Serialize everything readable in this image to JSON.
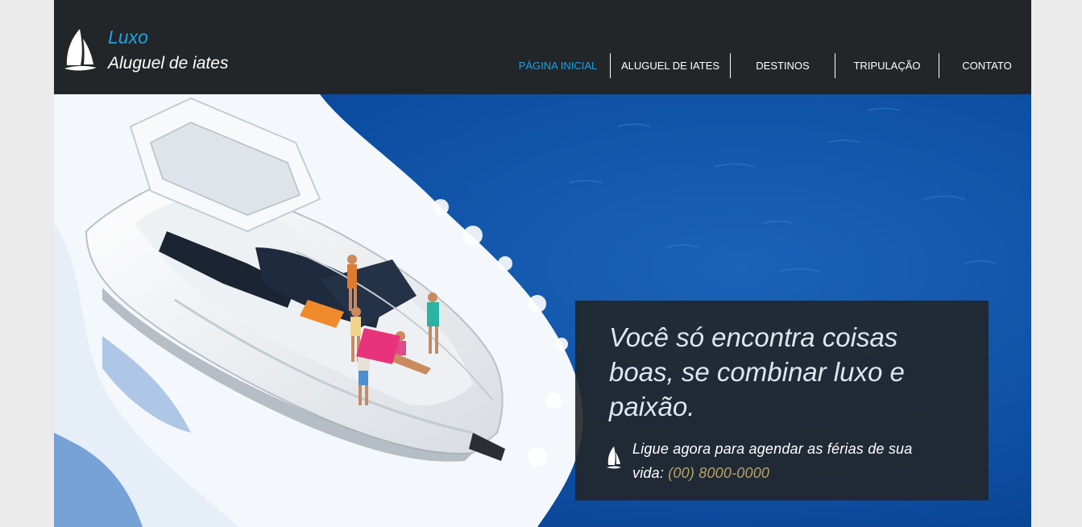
{
  "brand": {
    "name": "Luxo",
    "tagline": "Aluguel de iates",
    "accent_color": "#1fa3e0",
    "icon": "sailboat-icon"
  },
  "nav": {
    "items": [
      {
        "label": "PÁGINA INICIAL",
        "active": true
      },
      {
        "label": "ALUGUEL DE IATES",
        "active": false
      },
      {
        "label": "DESTINOS",
        "active": false
      },
      {
        "label": "TRIPULAÇÃO",
        "active": false
      },
      {
        "label": "CONTATO",
        "active": false
      }
    ]
  },
  "hero": {
    "image": "yacht-on-ocean",
    "headline": "Você só encontra coisas boas, se combinar luxo e paixão.",
    "call_text": "Ligue agora para agendar as férias de sua vida: ",
    "phone": "(00) 8000-0000",
    "phone_color": "#b8a06a",
    "icon": "sailboat-icon"
  }
}
